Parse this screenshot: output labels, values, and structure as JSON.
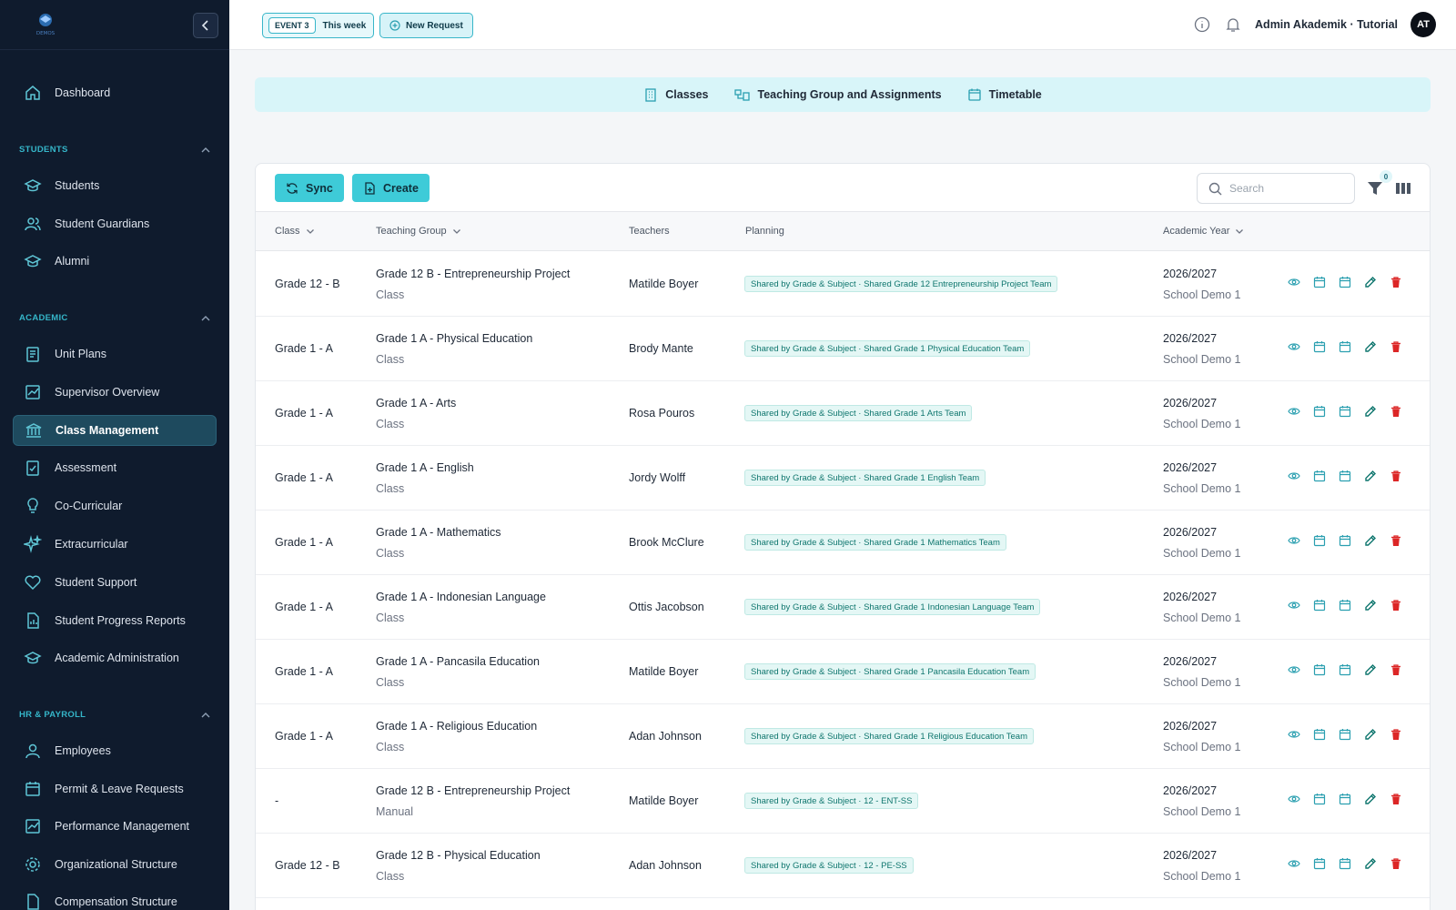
{
  "sidebar": {
    "logo_text": "DEMOS",
    "items": [
      {
        "label": "Dashboard"
      },
      {
        "label": "Students"
      },
      {
        "label": "Student Guardians"
      },
      {
        "label": "Alumni"
      },
      {
        "label": "Unit Plans"
      },
      {
        "label": "Supervisor Overview"
      },
      {
        "label": "Class Management",
        "active": true
      },
      {
        "label": "Assessment"
      },
      {
        "label": "Co-Curricular"
      },
      {
        "label": "Extracurricular"
      },
      {
        "label": "Student Support"
      },
      {
        "label": "Student Progress Reports"
      },
      {
        "label": "Academic Administration"
      },
      {
        "label": "Employees"
      },
      {
        "label": "Permit & Leave Requests"
      },
      {
        "label": "Performance Management"
      },
      {
        "label": "Organizational Structure"
      },
      {
        "label": "Compensation Structure"
      }
    ],
    "sections": [
      {
        "label": "STUDENTS"
      },
      {
        "label": "ACADEMIC"
      },
      {
        "label": "HR & PAYROLL"
      }
    ]
  },
  "topbar": {
    "event_tag": "EVENT 3",
    "event_label": "This week",
    "new_request_label": "New Request",
    "user_name": "Admin Akademik · Tutorial",
    "avatar_initials": "AT"
  },
  "tabs": [
    {
      "label": "Classes",
      "icon": "building-icon"
    },
    {
      "label": "Teaching Group and Assignments",
      "icon": "group-icon"
    },
    {
      "label": "Timetable",
      "icon": "calendar-icon"
    }
  ],
  "toolbar": {
    "sync_label": "Sync",
    "create_label": "Create",
    "search_placeholder": "Search",
    "filter_count": "0"
  },
  "table": {
    "columns": [
      "Class",
      "Teaching Group",
      "Teachers",
      "Planning",
      "Academic Year"
    ],
    "rows": [
      {
        "class": "Grade 12 - B",
        "group": "Grade 12 B - Entrepreneurship Project",
        "group_type": "Class",
        "teacher": "Matilde Boyer",
        "planning": "Shared by Grade & Subject · Shared Grade 12 Entrepreneurship Project Team",
        "year": "2026/2027",
        "school": "School Demo 1"
      },
      {
        "class": "Grade 1 - A",
        "group": "Grade 1 A - Physical Education",
        "group_type": "Class",
        "teacher": "Brody Mante",
        "planning": "Shared by Grade & Subject · Shared Grade 1 Physical Education Team",
        "year": "2026/2027",
        "school": "School Demo 1"
      },
      {
        "class": "Grade 1 - A",
        "group": "Grade 1 A - Arts",
        "group_type": "Class",
        "teacher": "Rosa Pouros",
        "planning": "Shared by Grade & Subject · Shared Grade 1 Arts Team",
        "year": "2026/2027",
        "school": "School Demo 1"
      },
      {
        "class": "Grade 1 - A",
        "group": "Grade 1 A - English",
        "group_type": "Class",
        "teacher": "Jordy Wolff",
        "planning": "Shared by Grade & Subject · Shared Grade 1 English Team",
        "year": "2026/2027",
        "school": "School Demo 1"
      },
      {
        "class": "Grade 1 - A",
        "group": "Grade 1 A - Mathematics",
        "group_type": "Class",
        "teacher": "Brook McClure",
        "planning": "Shared by Grade & Subject · Shared Grade 1 Mathematics Team",
        "year": "2026/2027",
        "school": "School Demo 1"
      },
      {
        "class": "Grade 1 - A",
        "group": "Grade 1 A - Indonesian Language",
        "group_type": "Class",
        "teacher": "Ottis Jacobson",
        "planning": "Shared by Grade & Subject · Shared Grade 1 Indonesian Language Team",
        "year": "2026/2027",
        "school": "School Demo 1"
      },
      {
        "class": "Grade 1 - A",
        "group": "Grade 1 A - Pancasila Education",
        "group_type": "Class",
        "teacher": "Matilde Boyer",
        "planning": "Shared by Grade & Subject · Shared Grade 1 Pancasila Education Team",
        "year": "2026/2027",
        "school": "School Demo 1"
      },
      {
        "class": "Grade 1 - A",
        "group": "Grade 1 A - Religious Education",
        "group_type": "Class",
        "teacher": "Adan Johnson",
        "planning": "Shared by Grade & Subject · Shared Grade 1 Religious Education Team",
        "year": "2026/2027",
        "school": "School Demo 1"
      },
      {
        "class": "-",
        "group": "Grade 12 B - Entrepreneurship Project",
        "group_type": "Manual",
        "teacher": "Matilde Boyer",
        "planning": "Shared by Grade & Subject · 12 - ENT-SS",
        "year": "2026/2027",
        "school": "School Demo 1"
      },
      {
        "class": "Grade 12 - B",
        "group": "Grade 12 B - Physical Education",
        "group_type": "Class",
        "teacher": "Adan Johnson",
        "planning": "Shared by Grade & Subject · 12 - PE-SS",
        "year": "2026/2027",
        "school": "School Demo 1"
      }
    ]
  },
  "colors": {
    "sidebar_bg": "#0f1b2d",
    "accent": "#3ecbd8",
    "tabnav_bg": "#d8f5f9",
    "delete": "#dc2626",
    "edit": "#0f766e"
  }
}
